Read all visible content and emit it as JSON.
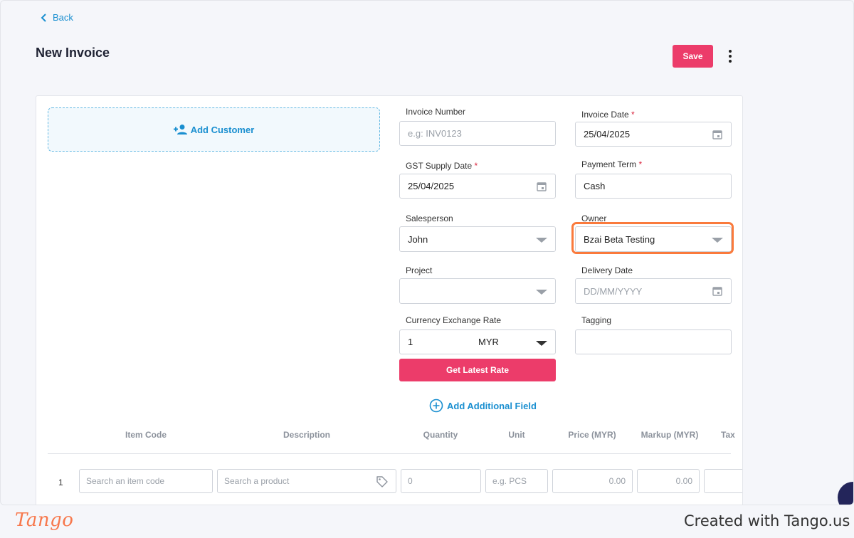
{
  "nav": {
    "back_label": "Back"
  },
  "header": {
    "title": "New Invoice",
    "save_label": "Save"
  },
  "customer": {
    "add_label": "Add Customer"
  },
  "form": {
    "invoice_number": {
      "label": "Invoice Number",
      "placeholder": "e.g: INV0123"
    },
    "invoice_date": {
      "label": "Invoice Date",
      "required": "*",
      "value": "25/04/2025"
    },
    "gst_supply_date": {
      "label": "GST Supply Date",
      "required": "*",
      "value": "25/04/2025"
    },
    "payment_term": {
      "label": "Payment Term",
      "required": "*",
      "value": "Cash"
    },
    "salesperson": {
      "label": "Salesperson",
      "value": "John"
    },
    "owner": {
      "label": "Owner",
      "value": "Bzai Beta Testing"
    },
    "project": {
      "label": "Project",
      "value": ""
    },
    "delivery_date": {
      "label": "Delivery Date",
      "placeholder": "DD/MM/YYYY"
    },
    "currency_rate": {
      "label": "Currency Exchange Rate",
      "value": "1",
      "currency": "MYR"
    },
    "tagging": {
      "label": "Tagging",
      "value": ""
    },
    "get_rate_label": "Get Latest Rate",
    "add_field_label": "Add Additional Field"
  },
  "table": {
    "headers": [
      "Item Code",
      "Description",
      "Quantity",
      "Unit",
      "Price (MYR)",
      "Markup (MYR)",
      "Tax"
    ],
    "rows": [
      {
        "number": "1",
        "item_code_placeholder": "Search an item code",
        "description_placeholder": "Search a product",
        "quantity_placeholder": "0",
        "unit_placeholder": "e.g. PCS",
        "price_placeholder": "0.00",
        "markup_placeholder": "0.00"
      }
    ]
  },
  "footer": {
    "brand": "Tango",
    "credit": "Created with Tango.us"
  },
  "colors": {
    "accent": "#ec3c6a",
    "link": "#1a8fd0",
    "highlight": "#fa7a3c"
  }
}
